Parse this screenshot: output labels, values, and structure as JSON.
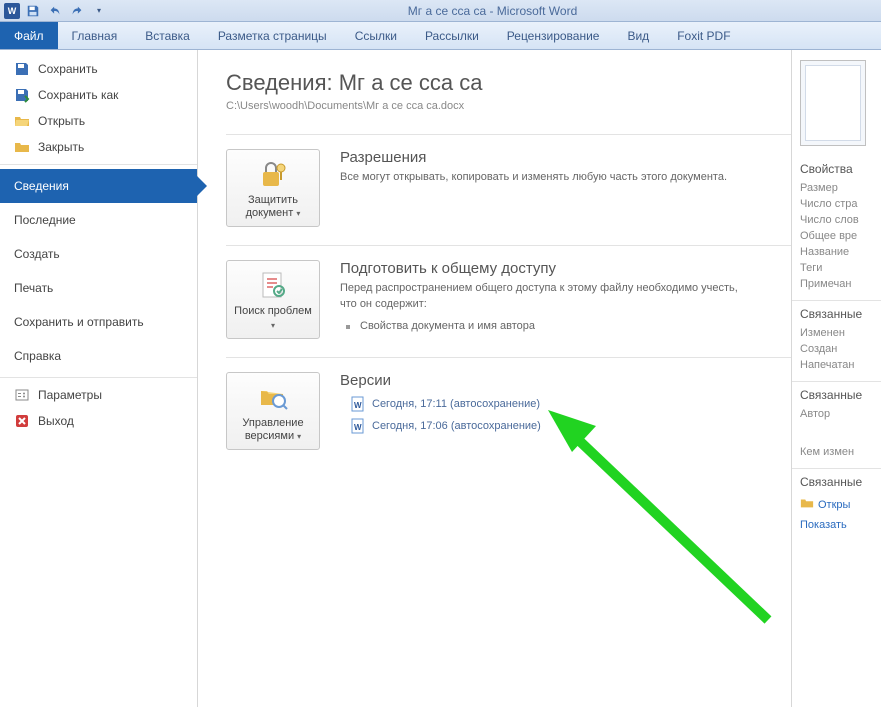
{
  "titlebar": {
    "title": "Мг а се  сса са  -  Microsoft Word"
  },
  "ribbon": {
    "file": "Файл",
    "tabs": [
      "Главная",
      "Вставка",
      "Разметка страницы",
      "Ссылки",
      "Рассылки",
      "Рецензирование",
      "Вид",
      "Foxit PDF"
    ]
  },
  "sidebar": {
    "top": [
      {
        "label": "Сохранить"
      },
      {
        "label": "Сохранить как"
      },
      {
        "label": "Открыть"
      },
      {
        "label": "Закрыть"
      }
    ],
    "major": [
      {
        "label": "Сведения",
        "active": true
      },
      {
        "label": "Последние"
      },
      {
        "label": "Создать"
      },
      {
        "label": "Печать"
      },
      {
        "label": "Сохранить и отправить"
      },
      {
        "label": "Справка"
      }
    ],
    "bottom": [
      {
        "label": "Параметры"
      },
      {
        "label": "Выход"
      }
    ]
  },
  "main": {
    "heading": "Сведения: Мг а се  сса са",
    "path": "C:\\Users\\woodh\\Documents\\Мг а се  сса са.docx",
    "perm": {
      "btn": "Защитить документ",
      "title": "Разрешения",
      "desc": "Все могут открывать, копировать и изменять любую часть этого документа."
    },
    "share": {
      "btn": "Поиск проблем",
      "title": "Подготовить к общему доступу",
      "desc": "Перед распространением общего доступа к этому файлу необходимо учесть, что он содержит:",
      "bullet": "Свойства документа и имя автора"
    },
    "versions": {
      "btn": "Управление версиями",
      "title": "Версии",
      "items": [
        "Сегодня, 17:11 (автосохранение)",
        "Сегодня, 17:06 (автосохранение)"
      ]
    }
  },
  "props": {
    "heading": "Свойства",
    "rows1": [
      "Размер",
      "Число стра",
      "Число слов",
      "Общее вре",
      "Название",
      "Теги",
      "Примечан"
    ],
    "heading2": "Связанные",
    "rows2": [
      "Изменен",
      "Создан",
      "Напечатан"
    ],
    "heading3": "Связанные",
    "rows3": [
      "Автор"
    ],
    "who": "Кем измен",
    "heading4": "Связанные",
    "openloc": "Откры",
    "showall": "Показать"
  }
}
